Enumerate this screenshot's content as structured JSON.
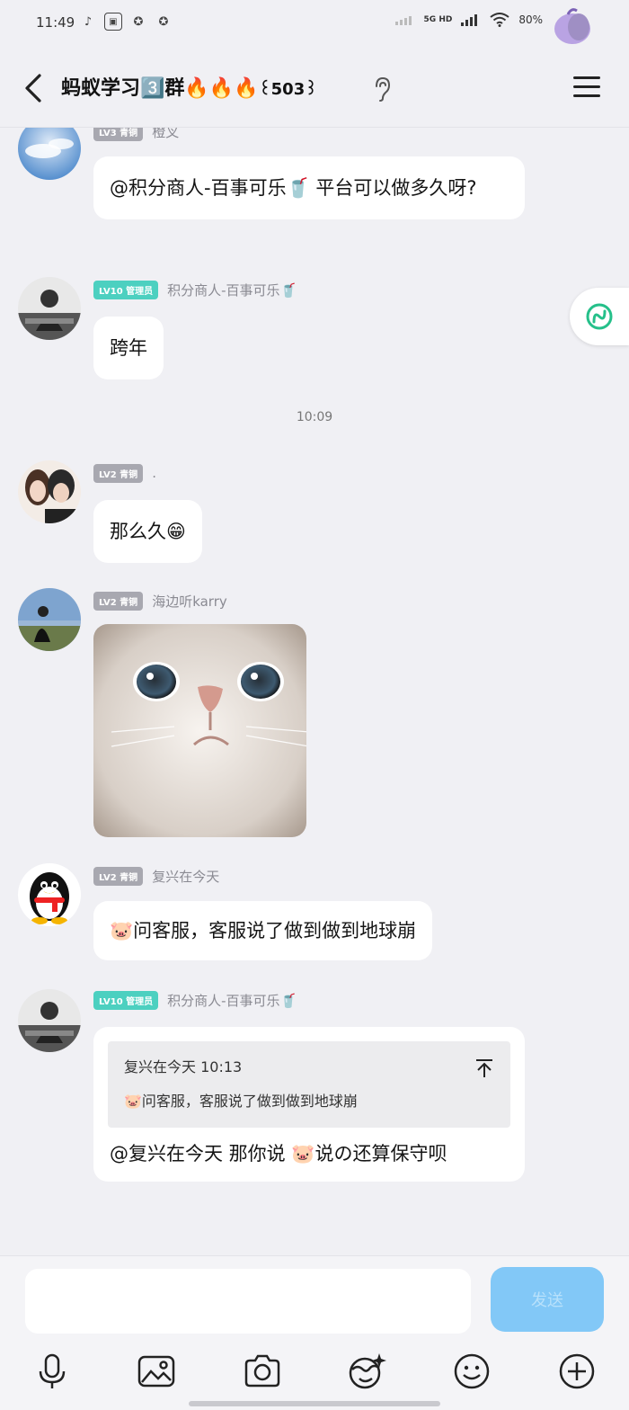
{
  "status_bar": {
    "time": "11:49",
    "network": "5G HD",
    "battery": "80%"
  },
  "header": {
    "title": "蚂蚁学习3️⃣群🔥🔥🔥",
    "member_count": "꒰503꒱"
  },
  "messages": [
    {
      "badge": "LV3 青铜",
      "sender": "橙叉",
      "text": "@积分商人-百事可乐🥤  平台可以做多久呀?"
    },
    {
      "badge": "LV10 管理员",
      "sender": "积分商人-百事可乐🥤",
      "text": "跨年"
    },
    {
      "time_divider": "10:09"
    },
    {
      "badge": "LV2 青铜",
      "sender": ".",
      "text": "那么久😁"
    },
    {
      "badge": "LV2 青铜",
      "sender": "海边听karry",
      "image_alt": "white kitten face close-up"
    },
    {
      "badge": "LV2 青铜",
      "sender": "复兴在今天",
      "text": "🐷问客服，客服说了做到做到地球崩"
    },
    {
      "badge": "LV10 管理员",
      "sender": "积分商人-百事可乐🥤",
      "quote_head": "复兴在今天  10:13",
      "quote_body": "🐷问客服，客服说了做到做到地球崩",
      "text": "@复兴在今天    那你说  🐷说の还算保守呗"
    }
  ],
  "input": {
    "placeholder": "",
    "send_label": "发送"
  },
  "toolbar": {
    "items": [
      "mic-icon",
      "image-icon",
      "camera-icon",
      "doodle-icon",
      "emoji-icon",
      "plus-icon"
    ]
  },
  "colors": {
    "admin_badge": "#4cd0c0",
    "normal_badge": "#a8a8b0",
    "send_button": "#82c8f7"
  }
}
